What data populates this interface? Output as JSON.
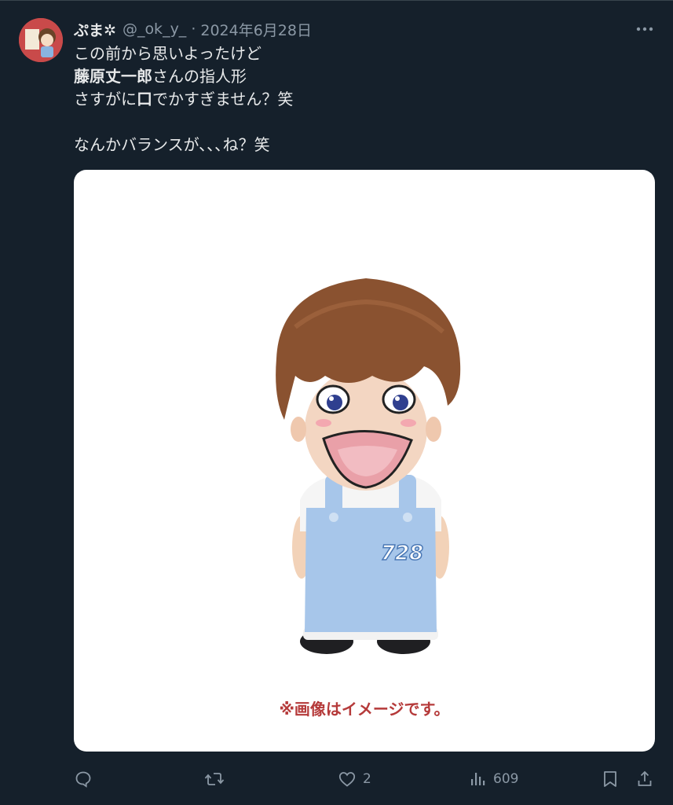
{
  "tweet": {
    "display_name": "ぷま",
    "display_name_suffix": "✲",
    "handle": "@_ok_y_",
    "separator": "·",
    "date": "2024年6月28日",
    "more_label": "•••",
    "lines": [
      {
        "text": "この前から思いよったけど",
        "bold_prefix": ""
      },
      {
        "text": "さんの指人形",
        "bold_prefix": "藤原丈一郎"
      },
      {
        "text": "でかすぎません？笑",
        "bold_prefix": "",
        "pre": "さすがに",
        "bold_mid": "口"
      },
      {
        "text": "",
        "bold_prefix": ""
      },
      {
        "text": "なんかバランスが､､､ね？笑",
        "bold_prefix": ""
      }
    ],
    "media": {
      "caption": "※画像はイメージです。",
      "badge_number": "728"
    },
    "actions": {
      "reply_count": "",
      "retweet_count": "",
      "like_count": "2",
      "views_count": "609"
    }
  },
  "colors": {
    "background": "#15202b",
    "text": "#e7e9ea",
    "muted": "#8b98a5",
    "caption": "#b53a3a"
  }
}
